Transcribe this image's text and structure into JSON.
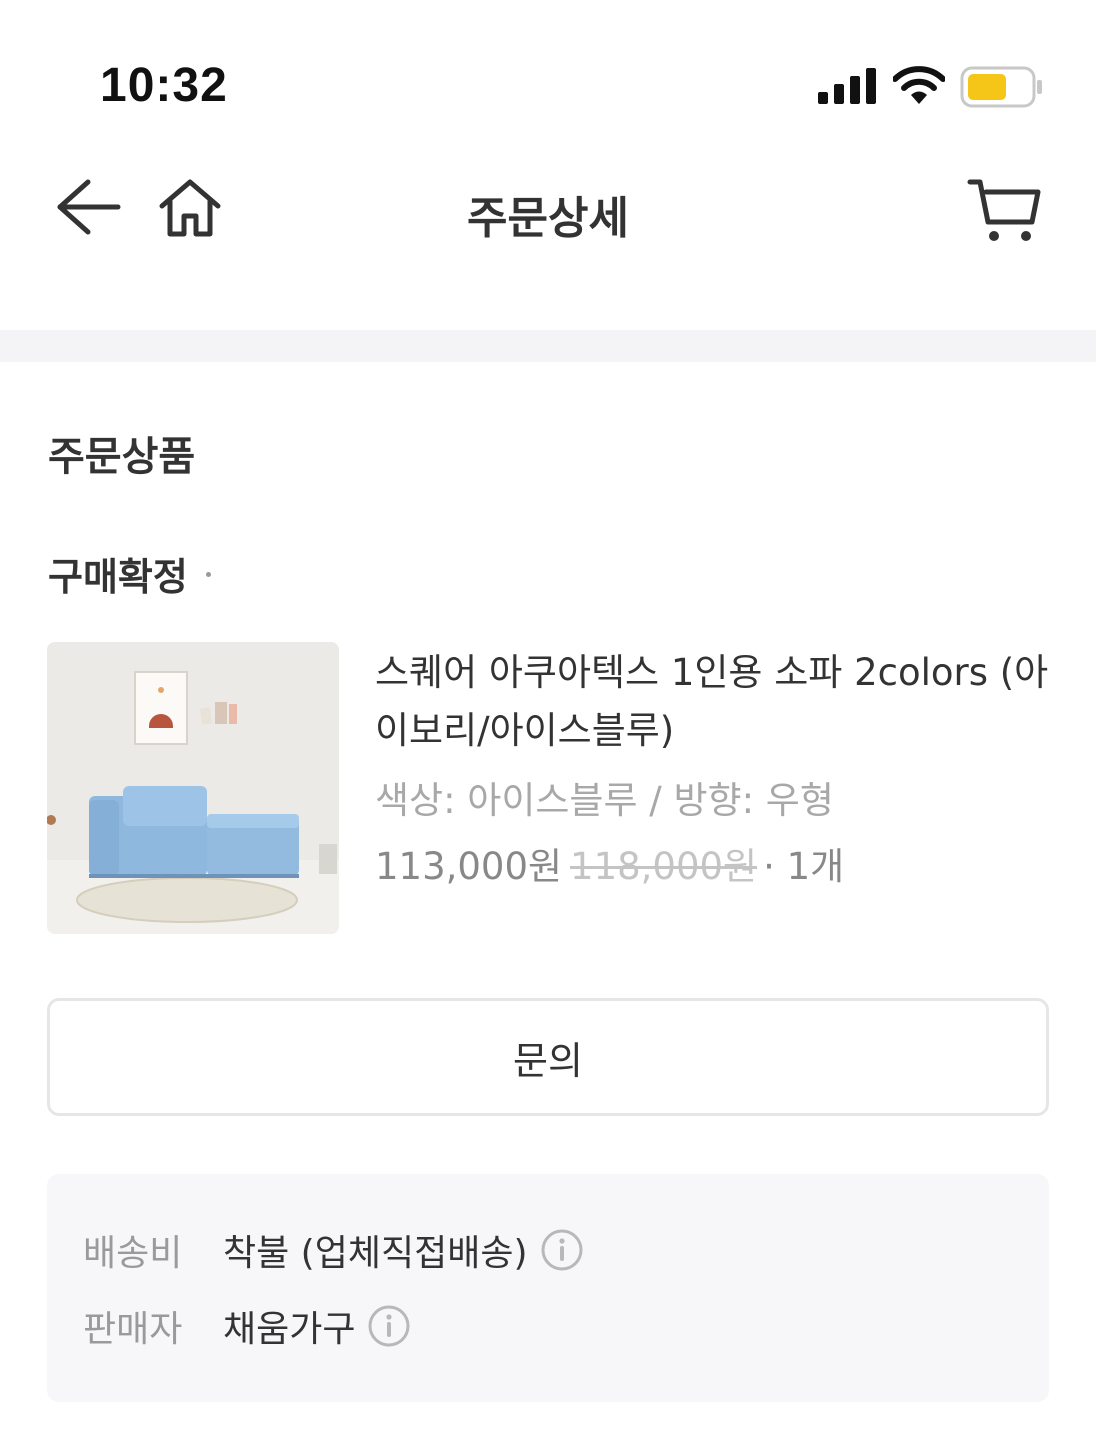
{
  "status_bar": {
    "time": "10:32"
  },
  "nav": {
    "title": "주문상세"
  },
  "section": {
    "title": "주문상품"
  },
  "order": {
    "status": "구매확정"
  },
  "product": {
    "name": "스퀘어 아쿠아텍스 1인용 소파 2colors (아이보리/아이스블루)",
    "option": "색상: 아이스블루 / 방향: 우형",
    "price": "113,000원",
    "original_price": "118,000원",
    "quantity": "· 1개"
  },
  "inquiry": {
    "label": "문의"
  },
  "info": {
    "shipping_label": "배송비",
    "shipping_value": "착불 (업체직접배송)",
    "seller_label": "판매자",
    "seller_value": "채움가구"
  },
  "colors": {
    "battery": "#f5c518",
    "divider": "#f4f4f6",
    "info_bg": "#f7f7f9"
  }
}
